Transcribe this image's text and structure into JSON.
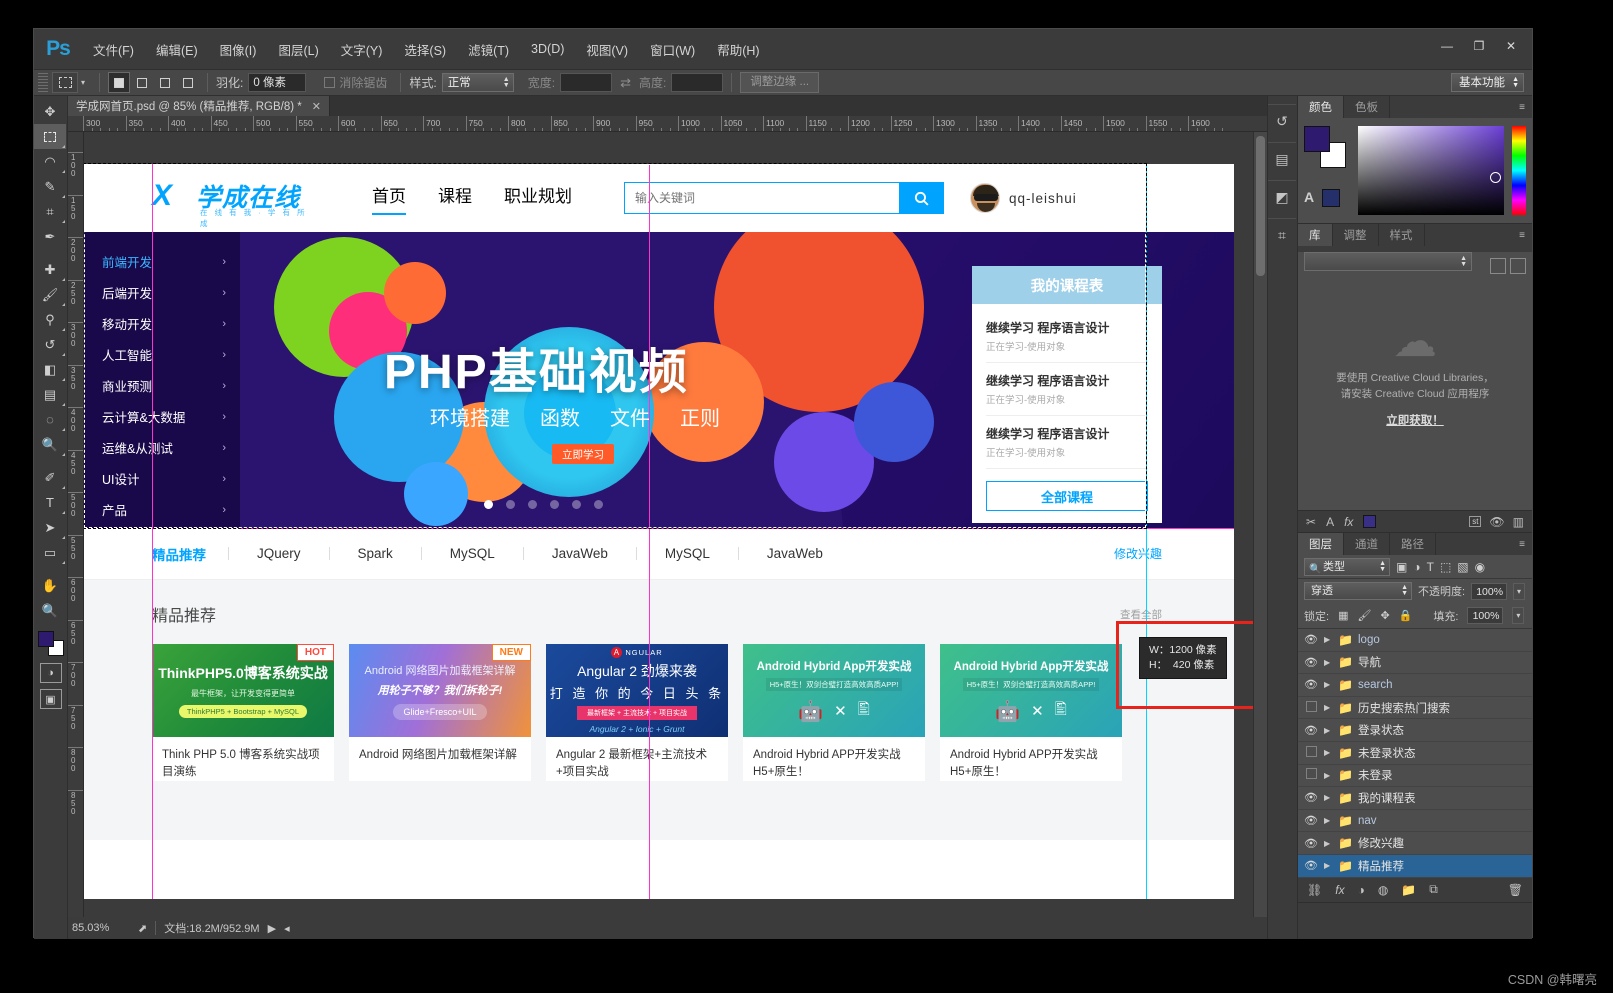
{
  "app": {
    "name": "Ps"
  },
  "menubar": {
    "items": [
      "文件(F)",
      "编辑(E)",
      "图像(I)",
      "图层(L)",
      "文字(Y)",
      "选择(S)",
      "滤镜(T)",
      "3D(D)",
      "视图(V)",
      "窗口(W)",
      "帮助(H)"
    ],
    "minimize": "—",
    "maximize": "❐",
    "close": "✕"
  },
  "options_bar": {
    "feather_label": "羽化:",
    "feather_value": "0 像素",
    "antialias_label": "消除锯齿",
    "style_label": "样式:",
    "style_value": "正常",
    "width_label": "宽度:",
    "width_value": "",
    "height_label": "高度:",
    "height_value": "",
    "refine_edge": "调整边缘 ...",
    "workspace": "基本功能"
  },
  "document": {
    "tab_title": "学成网首页.psd @ 85% (精品推荐, RGB/8) *",
    "close": "✕"
  },
  "ruler": {
    "h_ticks": [
      "300",
      "350",
      "400",
      "450",
      "500",
      "550",
      "600",
      "650",
      "700",
      "750",
      "800",
      "850",
      "900",
      "950",
      "1000",
      "1050",
      "1100",
      "1150",
      "1200",
      "1250",
      "1300",
      "1350",
      "1400",
      "1450",
      "1500",
      "1550",
      "1600"
    ],
    "v_ticks": [
      "100",
      "150",
      "200",
      "250",
      "300",
      "350",
      "400",
      "450",
      "500",
      "550",
      "600",
      "650",
      "700",
      "750",
      "800",
      "850"
    ]
  },
  "selection_tip": {
    "w_line": "W：1200 像素",
    "h_line": "H：  420 像素"
  },
  "website": {
    "logo": {
      "mark": "X",
      "name": "学成在线",
      "tagline": "在 线 有 我 · 学 有 所 成"
    },
    "nav": [
      {
        "label": "首页",
        "active": true
      },
      {
        "label": "课程",
        "active": false
      },
      {
        "label": "职业规划",
        "active": false
      }
    ],
    "search": {
      "placeholder": "输入关键词",
      "icon": "search-icon"
    },
    "user": {
      "name": "qq-leishui"
    },
    "banner": {
      "side_menu": [
        {
          "label": "前端开发",
          "active": true
        },
        {
          "label": "后端开发",
          "active": false
        },
        {
          "label": "移动开发",
          "active": false
        },
        {
          "label": "人工智能",
          "active": false
        },
        {
          "label": "商业预测",
          "active": false
        },
        {
          "label": "云计算&大数据",
          "active": false
        },
        {
          "label": "运维&从测试",
          "active": false
        },
        {
          "label": "UI设计",
          "active": false
        },
        {
          "label": "产品",
          "active": false
        }
      ],
      "title": "PHP基础视频",
      "subtitles": [
        "环境搭建",
        "函数",
        "文件",
        "正则"
      ],
      "cta": "立即学习",
      "dots": 6,
      "active_dot": 0
    },
    "schedule": {
      "header": "我的课程表",
      "items": [
        {
          "title": "继续学习 程序语言设计",
          "sub": "正在学习-使用对象"
        },
        {
          "title": "继续学习 程序语言设计",
          "sub": "正在学习-使用对象"
        },
        {
          "title": "继续学习 程序语言设计",
          "sub": "正在学习-使用对象"
        }
      ],
      "all_button": "全部课程"
    },
    "tabs": [
      "精品推荐",
      "JQuery",
      "Spark",
      "MySQL",
      "JavaWeb",
      "MySQL",
      "JavaWeb"
    ],
    "tabs_right": "修改兴趣",
    "recommend": {
      "heading": "精品推荐",
      "view_all": "查看全部",
      "cards": [
        {
          "badge": "HOT",
          "badge_type": "hot",
          "img_l1": "ThinkPHP5.0博客系统实战",
          "img_l2": "最牛框架，让开发变得更简单",
          "img_l3": "ThinkPHP5 + Bootstrap + MySQL",
          "title": "Think PHP 5.0 博客系统实战项目演练"
        },
        {
          "badge": "NEW",
          "badge_type": "new",
          "img_l1": "Android 网络图片加载框架详解",
          "img_l2": "用轮子不够？我们拆轮子!",
          "img_l3": "Glide+Fresco+UIL",
          "title": "Android 网络图片加载框架详解"
        },
        {
          "badge": "",
          "badge_type": "",
          "img_brand": "NGULAR",
          "img_l1": "Angular 2 劲爆来袭",
          "img_l2": "打 造 你 的 今 日 头 条",
          "img_l3": "最新框架 + 主流技术 + 项目实战",
          "img_l4": "Angular 2 + Ionic + Grunt",
          "title": "Angular 2 最新框架+主流技术+项目实战"
        },
        {
          "badge": "",
          "badge_type": "",
          "img_l1": "Android Hybrid App开发实战",
          "img_l2": "H5+原生！双剑合璧打造高效高质APP!",
          "title": "Android Hybrid APP开发实战 H5+原生！"
        },
        {
          "badge": "",
          "badge_type": "",
          "img_l1": "Android Hybrid App开发实战",
          "img_l2": "H5+原生！双剑合璧打造高效高质APP!",
          "title": "Android Hybrid APP开发实战 H5+原生！"
        }
      ]
    }
  },
  "status_bar": {
    "zoom": "85.03%",
    "doc_label": "文档:18.2M/952.9M"
  },
  "right_dock": {
    "color_panel": {
      "tabs": [
        "颜色",
        "色板"
      ],
      "active_tab": "颜色",
      "foreground": "#2e1a6e",
      "background": "#ffffff"
    },
    "library_panel": {
      "tabs": [
        "库",
        "调整",
        "样式"
      ],
      "active_tab": "库",
      "empty_line1": "要使用 Creative Cloud Libraries，",
      "empty_line2": "请安装 Creative Cloud 应用程序",
      "link": "立即获取！"
    },
    "layers_panel": {
      "tabs": [
        "图层",
        "通道",
        "路径"
      ],
      "active_tab": "图层",
      "filter_value": "类型",
      "blend_value": "穿透",
      "opacity_label": "不透明度:",
      "opacity_value": "100%",
      "lock_label": "锁定:",
      "fill_label": "填充:",
      "fill_value": "100%",
      "st_badge": "st",
      "layers": [
        {
          "name": "logo",
          "visible": true,
          "latin": true,
          "selected": false
        },
        {
          "name": "导航",
          "visible": true,
          "latin": false,
          "selected": false
        },
        {
          "name": "search",
          "visible": true,
          "latin": true,
          "selected": false
        },
        {
          "name": "历史搜索热门搜索",
          "visible": false,
          "latin": false,
          "selected": false
        },
        {
          "name": "登录状态",
          "visible": true,
          "latin": false,
          "selected": false
        },
        {
          "name": "未登录状态",
          "visible": false,
          "latin": false,
          "selected": false
        },
        {
          "name": "未登录",
          "visible": false,
          "latin": false,
          "selected": false
        },
        {
          "name": "我的课程表",
          "visible": true,
          "latin": false,
          "selected": false
        },
        {
          "name": "nav",
          "visible": true,
          "latin": true,
          "selected": false
        },
        {
          "name": "修改兴趣",
          "visible": true,
          "latin": false,
          "selected": false
        },
        {
          "name": "精品推荐",
          "visible": true,
          "latin": false,
          "selected": true
        }
      ]
    }
  },
  "watermark": "CSDN @韩曙亮"
}
